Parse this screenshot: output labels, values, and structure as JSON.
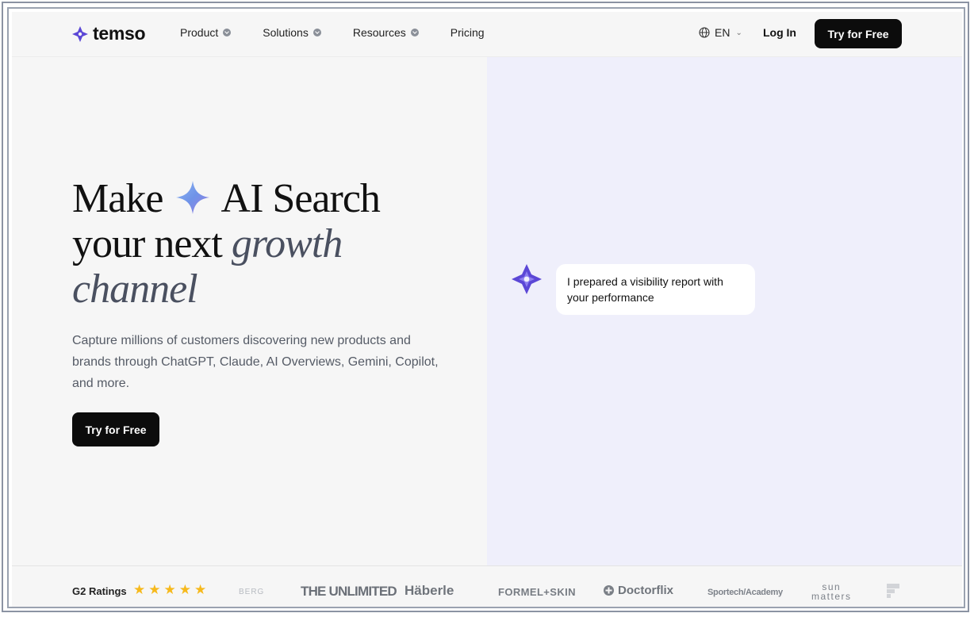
{
  "header": {
    "brand": "temso",
    "nav": [
      {
        "label": "Product",
        "has_dropdown": true
      },
      {
        "label": "Solutions",
        "has_dropdown": true
      },
      {
        "label": "Resources",
        "has_dropdown": true
      },
      {
        "label": "Pricing",
        "has_dropdown": false
      }
    ],
    "language": "EN",
    "login_label": "Log In",
    "cta_label": "Try for Free"
  },
  "hero": {
    "headline_part1": "Make",
    "headline_part2": "AI Search",
    "headline_part3": "your next",
    "headline_italic1": "growth",
    "headline_italic2": "channel",
    "subtext": "Capture millions of customers discovering new products and brands through ChatGPT, Claude, AI Overviews, Gemini, Copilot, and more.",
    "cta_label": "Try for Free"
  },
  "chat": {
    "message": "I prepared a visibility report with your performance"
  },
  "ratings": {
    "label": "G2 Ratings",
    "stars": 5
  },
  "logos": {
    "berg": "BERG",
    "unlimited": "THE UNLIMITED",
    "haberle": "Häberle",
    "formel": "FORMEL+SKIN",
    "doctorflix": "Doctorflix",
    "sportech": "Sportech/Academy",
    "sun": "sun",
    "matters": "matters"
  },
  "colors": {
    "brand_purple": "#5b47d6",
    "cta_black": "#0c0c0c",
    "hero_right_bg": "#efeffb",
    "star": "#f6b91c"
  }
}
